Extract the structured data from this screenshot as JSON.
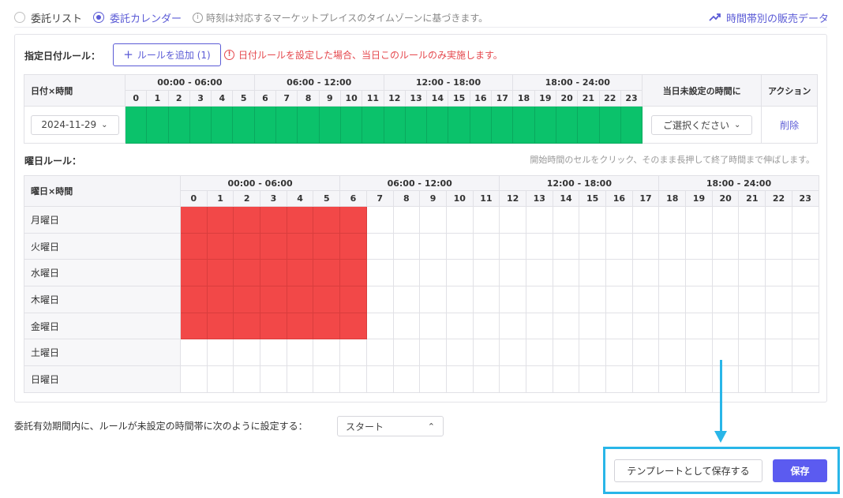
{
  "top": {
    "radio_list": "委託リスト",
    "radio_calendar": "委託カレンダー",
    "timezone_note": "時刻は対応するマーケットプレイスのタイムゾーンに基づきます。",
    "link_sales_by_time": "時間帯別の販売データ"
  },
  "date_rule": {
    "title": "指定日付ルール：",
    "add_button": "ルールを追加 (1)",
    "warning": "日付ルールを設定した場合、当日このルールのみ実施します。",
    "corner_label": "日付×時間",
    "col_unset": "当日未設定の時間に",
    "col_action": "アクション",
    "date_value": "2024-11-29",
    "select_placeholder": "ご選択ください",
    "delete_label": "削除",
    "hours_green": [
      0,
      1,
      2,
      3,
      4,
      5,
      6,
      7,
      8,
      9,
      10,
      11,
      12,
      13,
      14,
      15,
      16,
      17,
      18,
      19,
      20,
      21,
      22,
      23
    ]
  },
  "week_rule": {
    "title": "曜日ルール：",
    "hint": "開始時間のセルをクリック、そのまま長押して終了時間まで伸ばします。",
    "corner_label": "曜日×時間",
    "days": [
      "月曜日",
      "火曜日",
      "水曜日",
      "木曜日",
      "金曜日",
      "土曜日",
      "日曜日"
    ],
    "red_days": [
      0,
      1,
      2,
      3,
      4
    ],
    "red_hours": [
      0,
      1,
      2,
      3,
      4,
      5,
      6
    ]
  },
  "time_groups": [
    "00:00 - 06:00",
    "06:00 - 12:00",
    "12:00 - 18:00",
    "18:00 - 24:00"
  ],
  "hours": [
    "0",
    "1",
    "2",
    "3",
    "4",
    "5",
    "6",
    "7",
    "8",
    "9",
    "10",
    "11",
    "12",
    "13",
    "14",
    "15",
    "16",
    "17",
    "18",
    "19",
    "20",
    "21",
    "22",
    "23"
  ],
  "bottom": {
    "unset_label": "委託有効期間内に、ルールが未設定の時間帯に次のように設定する：",
    "unset_value": "スタート",
    "template_button": "テンプレートとして保存する",
    "save_button": "保存"
  },
  "colors": {
    "accent": "#5b5bd6",
    "green": "#0bc26b",
    "red": "#f24848",
    "highlight": "#29b6e8",
    "warning": "#e5484d"
  }
}
